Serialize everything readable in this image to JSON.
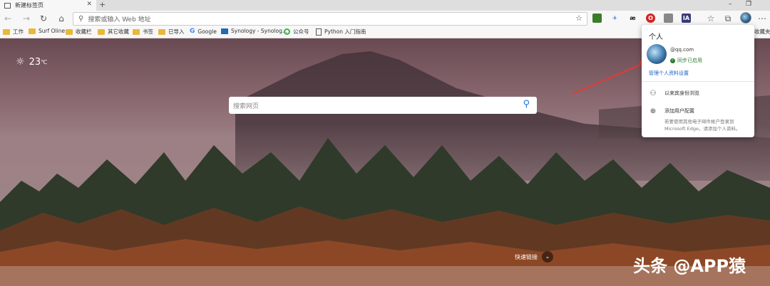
{
  "tab": {
    "title": "新建标签页",
    "close": "✕",
    "new_tab": "+"
  },
  "window_controls": {
    "minimize": "–",
    "restore": "❐"
  },
  "address_bar": {
    "placeholder": "搜索或输入 Web 地址"
  },
  "extensions": [
    {
      "name": "green-ext",
      "label": "",
      "color": "#3a7d2a"
    },
    {
      "name": "bird-ext",
      "label": "",
      "color": "#2b6cd8"
    },
    {
      "name": "ae-ext",
      "label": "æ",
      "color": "#222222"
    },
    {
      "name": "opera-ext",
      "label": "O",
      "color": "#d42222"
    },
    {
      "name": "tray-ext",
      "label": "",
      "color": "#666666"
    },
    {
      "name": "ia-ext",
      "label": "IA",
      "color": "#3b3b7a"
    }
  ],
  "favorites": [
    {
      "label": "工作",
      "icon": "folder-icon"
    },
    {
      "label": "Surf Oline",
      "icon": "folder-icon"
    },
    {
      "label": "收藏栏",
      "icon": "folder-icon"
    },
    {
      "label": "其它收藏",
      "icon": "folder-icon"
    },
    {
      "label": "书签",
      "icon": "folder-icon"
    },
    {
      "label": "已导入",
      "icon": "folder-icon"
    },
    {
      "label": "Google",
      "icon": "google-icon"
    },
    {
      "label": "Synology - Synolog...",
      "icon": "synology-icon"
    },
    {
      "label": "公众号",
      "icon": "wechat-icon"
    },
    {
      "label": "Python 入门指南",
      "icon": "page-icon"
    }
  ],
  "favorites_overflow": "收藏夹",
  "weather": {
    "temp": "23",
    "unit": "℃"
  },
  "search": {
    "placeholder": "搜索网页"
  },
  "quick_links": {
    "label": "快速链接"
  },
  "watermark": "头条 @APP猿",
  "profile_popup": {
    "title": "个人",
    "email": "@qq.com",
    "sync_status": "同步已启用",
    "manage_link": "管理个人资料设置",
    "guest_label": "以来宾身份浏览",
    "add_profile_label": "添加用户配置",
    "add_profile_desc": "若要使用其他电子邮件帐户登录到 Microsoft Edge，请添加个人资料。"
  }
}
